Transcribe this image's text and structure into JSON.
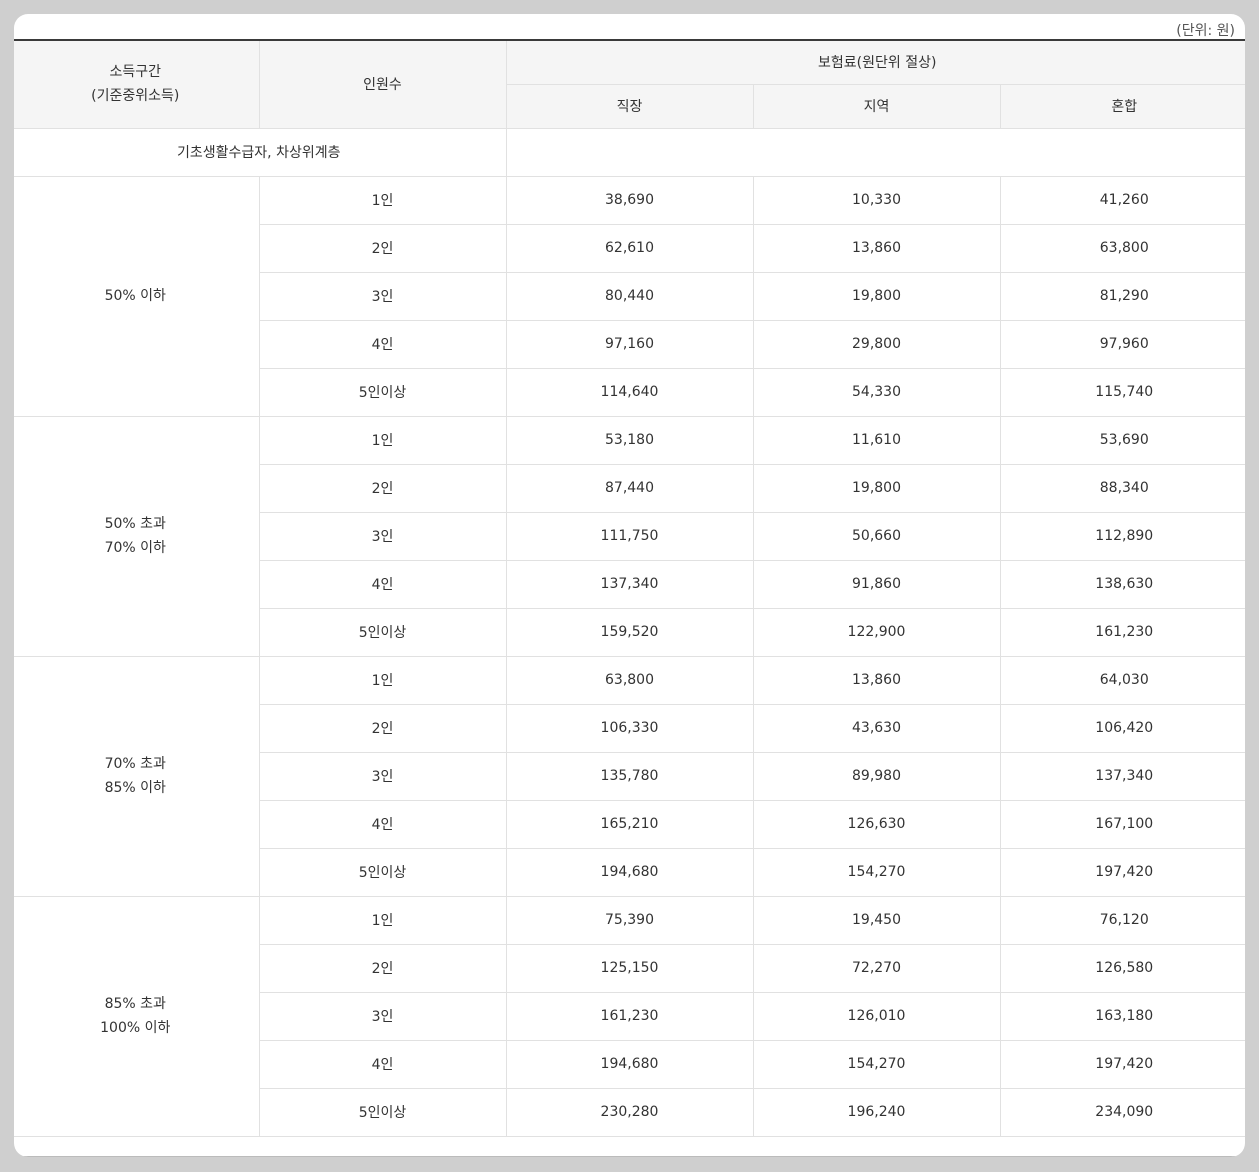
{
  "unit_note": "(단위: 원)",
  "header": {
    "income_col": "소득구간",
    "income_sub": "(기준중위소득)",
    "people_col": "인원수",
    "premium_group": "보험료(원단위 절상)",
    "employee": "직장",
    "regional": "지역",
    "mixed": "혼합"
  },
  "basic_row": {
    "label": "기초생활수급자, 차상위계층"
  },
  "groups": [
    {
      "label_line1": "50% 이하",
      "label_line2": "",
      "rows": [
        {
          "people": "1인",
          "employee": "38,690",
          "regional": "10,330",
          "mixed": "41,260"
        },
        {
          "people": "2인",
          "employee": "62,610",
          "regional": "13,860",
          "mixed": "63,800"
        },
        {
          "people": "3인",
          "employee": "80,440",
          "regional": "19,800",
          "mixed": "81,290"
        },
        {
          "people": "4인",
          "employee": "97,160",
          "regional": "29,800",
          "mixed": "97,960"
        },
        {
          "people": "5인이상",
          "employee": "114,640",
          "regional": "54,330",
          "mixed": "115,740"
        }
      ]
    },
    {
      "label_line1": "50% 초과",
      "label_line2": "70% 이하",
      "rows": [
        {
          "people": "1인",
          "employee": "53,180",
          "regional": "11,610",
          "mixed": "53,690"
        },
        {
          "people": "2인",
          "employee": "87,440",
          "regional": "19,800",
          "mixed": "88,340"
        },
        {
          "people": "3인",
          "employee": "111,750",
          "regional": "50,660",
          "mixed": "112,890"
        },
        {
          "people": "4인",
          "employee": "137,340",
          "regional": "91,860",
          "mixed": "138,630"
        },
        {
          "people": "5인이상",
          "employee": "159,520",
          "regional": "122,900",
          "mixed": "161,230"
        }
      ]
    },
    {
      "label_line1": "70% 초과",
      "label_line2": "85% 이하",
      "rows": [
        {
          "people": "1인",
          "employee": "63,800",
          "regional": "13,860",
          "mixed": "64,030"
        },
        {
          "people": "2인",
          "employee": "106,330",
          "regional": "43,630",
          "mixed": "106,420"
        },
        {
          "people": "3인",
          "employee": "135,780",
          "regional": "89,980",
          "mixed": "137,340"
        },
        {
          "people": "4인",
          "employee": "165,210",
          "regional": "126,630",
          "mixed": "167,100"
        },
        {
          "people": "5인이상",
          "employee": "194,680",
          "regional": "154,270",
          "mixed": "197,420"
        }
      ]
    },
    {
      "label_line1": "85% 초과",
      "label_line2": "100% 이하",
      "rows": [
        {
          "people": "1인",
          "employee": "75,390",
          "regional": "19,450",
          "mixed": "76,120"
        },
        {
          "people": "2인",
          "employee": "125,150",
          "regional": "72,270",
          "mixed": "126,580"
        },
        {
          "people": "3인",
          "employee": "161,230",
          "regional": "126,010",
          "mixed": "163,180"
        },
        {
          "people": "4인",
          "employee": "194,680",
          "regional": "154,270",
          "mixed": "197,420"
        },
        {
          "people": "5인이상",
          "employee": "230,280",
          "regional": "196,240",
          "mixed": "234,090"
        }
      ]
    }
  ]
}
